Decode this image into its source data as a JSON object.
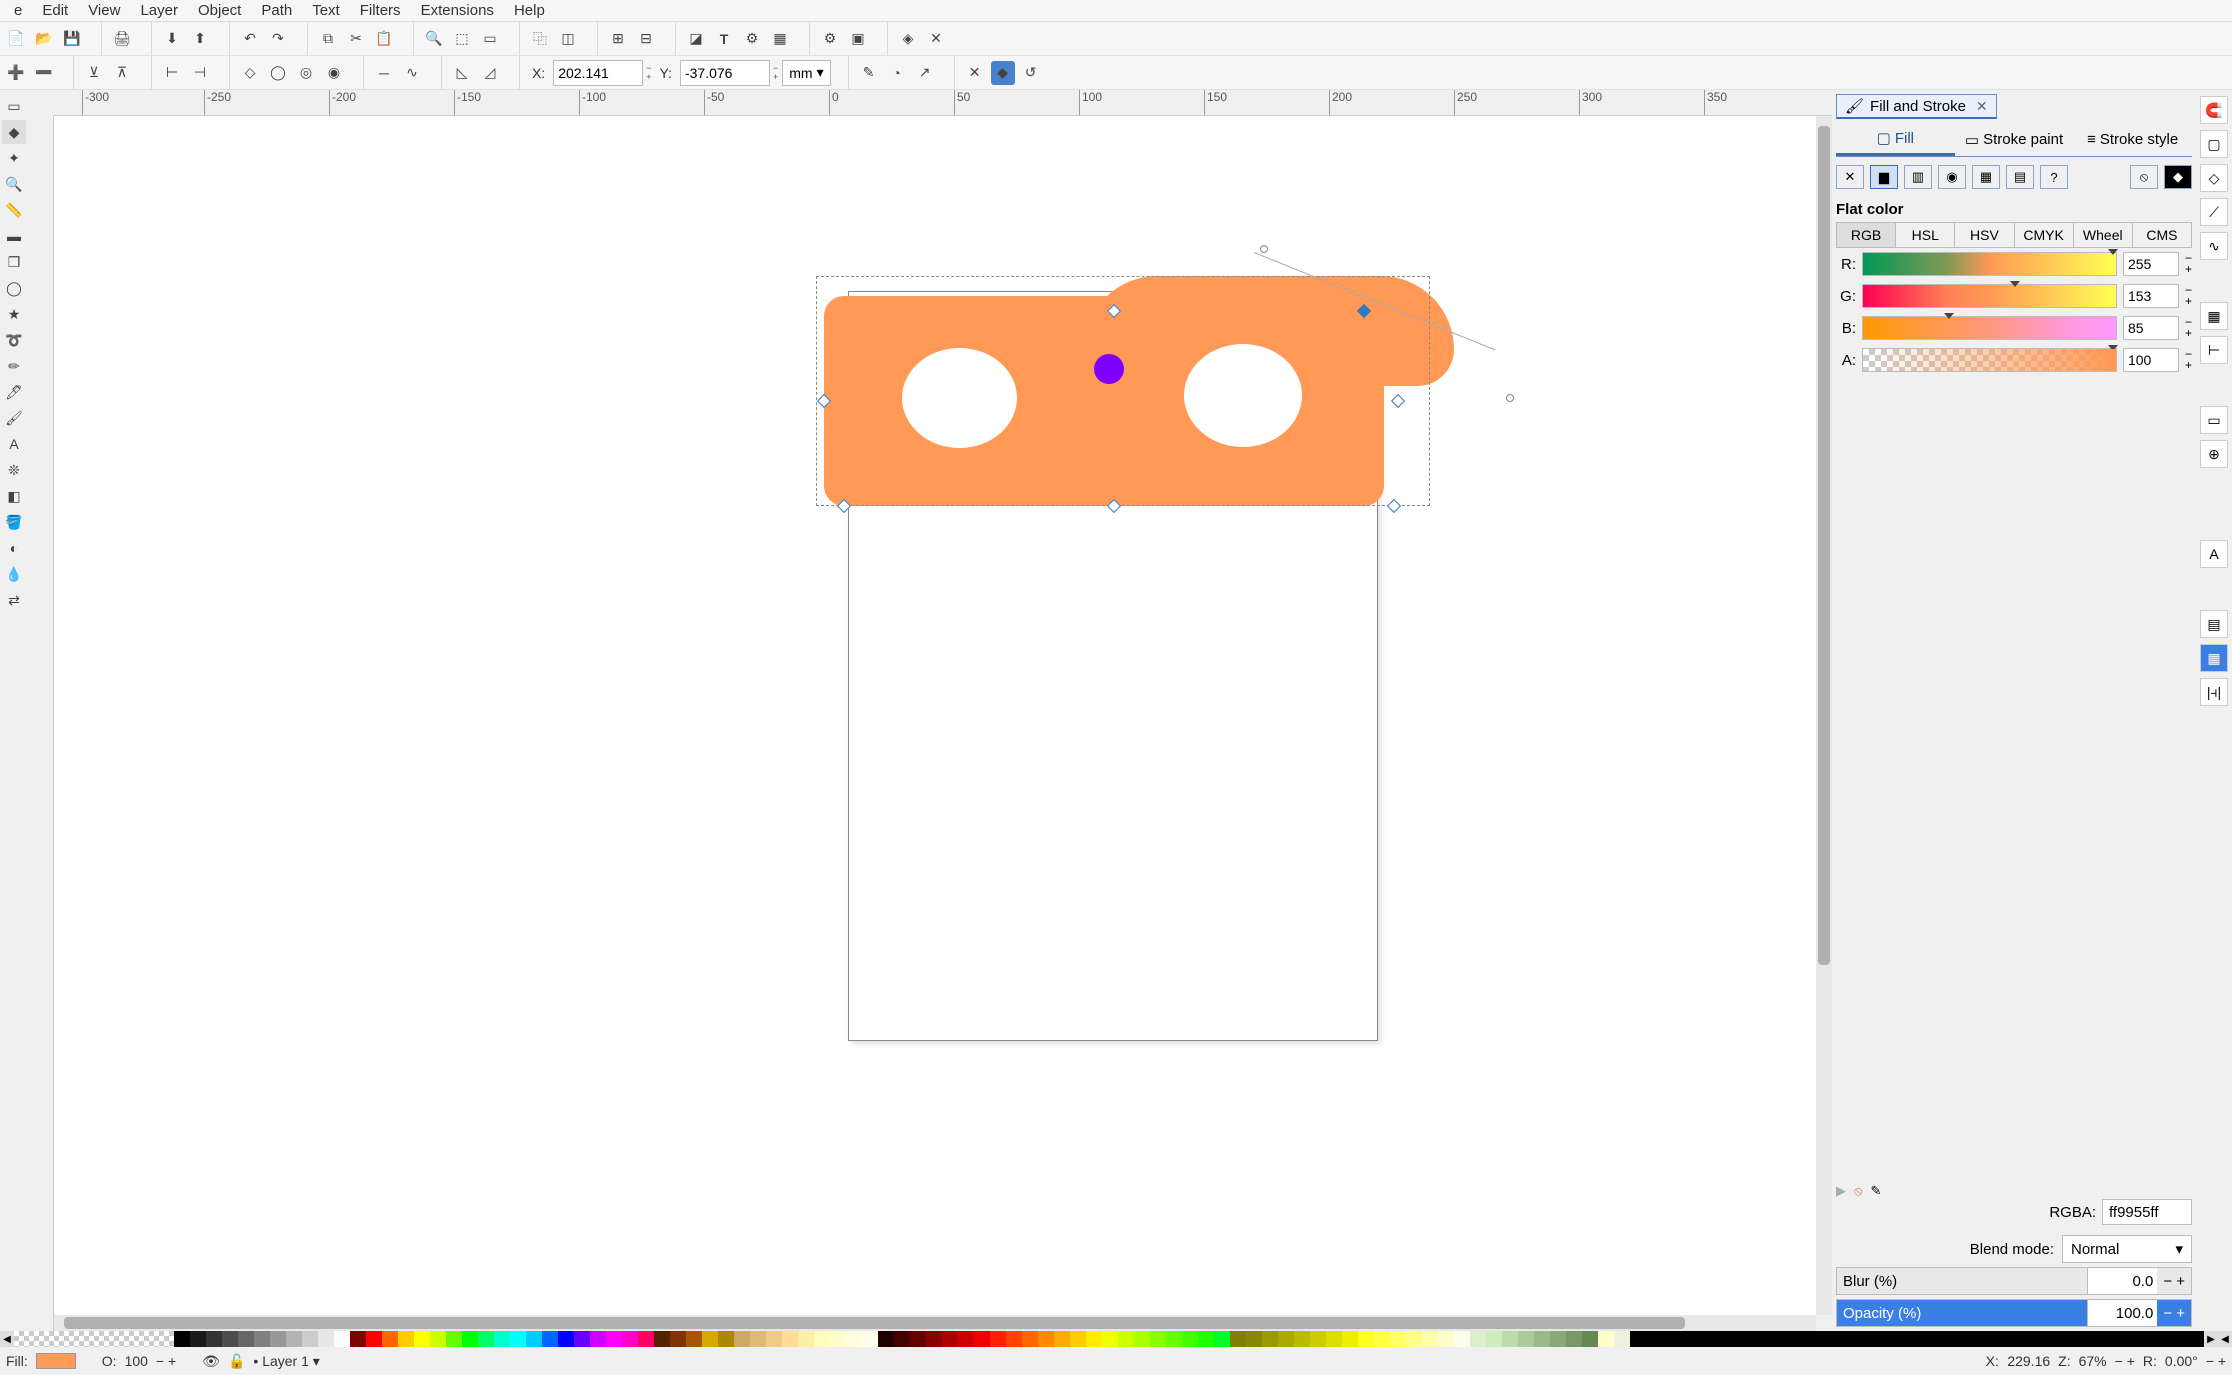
{
  "menubar": {
    "items": [
      "e",
      "Edit",
      "View",
      "Layer",
      "Object",
      "Path",
      "Text",
      "Filters",
      "Extensions",
      "Help"
    ]
  },
  "toolbar1_icons": [
    "new",
    "open",
    "save",
    "sep",
    "print",
    "sep",
    "import",
    "export",
    "sep",
    "undo",
    "redo",
    "sep",
    "copy",
    "cut",
    "paste",
    "sep",
    "clone",
    "unlink",
    "stamp",
    "sep",
    "zoom-sel",
    "zoom-draw",
    "zoom-page",
    "sep",
    "dup",
    "clone2",
    "sep",
    "text",
    "sep",
    "xml",
    "sep",
    "align",
    "sep",
    "props",
    "prefs",
    "sep",
    "spray",
    "sep",
    "fullscreen"
  ],
  "toolbar2": {
    "x_label": "X:",
    "x_value": "202.141",
    "y_label": "Y:",
    "y_value": "-37.076",
    "unit": "mm"
  },
  "ruler_h": [
    "-300",
    "-250",
    "-200",
    "-150",
    "-100",
    "-50",
    "0",
    "50",
    "100",
    "150",
    "200",
    "250",
    "300",
    "350"
  ],
  "ruler_v": [
    "",
    "",
    "",
    "",
    ""
  ],
  "fill_stroke": {
    "title": "Fill and Stroke",
    "tabs": {
      "fill": "Fill",
      "stroke_paint": "Stroke paint",
      "stroke_style": "Stroke style"
    },
    "flat_color": "Flat color",
    "color_tabs": [
      "RGB",
      "HSL",
      "HSV",
      "CMYK",
      "Wheel",
      "CMS"
    ],
    "r_label": "R:",
    "r_value": "255",
    "g_label": "G:",
    "g_value": "153",
    "b_label": "B:",
    "b_value": "85",
    "a_label": "A:",
    "a_value": "100",
    "rgba_label": "RGBA:",
    "rgba_value": "ff9955ff",
    "blend_label": "Blend mode:",
    "blend_value": "Normal",
    "blur_label": "Blur (%)",
    "blur_value": "0.0",
    "opacity_label": "Opacity (%)",
    "opacity_value": "100.0"
  },
  "status": {
    "fill_label": "Fill:",
    "o_label": "O:",
    "o_value": "100",
    "layer_value": "Layer 1",
    "coord_x_label": "X:",
    "coord_x_value": "229.16",
    "z_label": "Z:",
    "z_value": "67%",
    "r_label": "R:",
    "r_value": "0.00°"
  },
  "palette_colors": [
    "#000000",
    "#1a1a1a",
    "#333333",
    "#4d4d4d",
    "#666666",
    "#808080",
    "#999999",
    "#b3b3b3",
    "#cccccc",
    "#e6e6e6",
    "#ffffff",
    "#800000",
    "#ff0000",
    "#ff6600",
    "#ffcc00",
    "#ffff00",
    "#ccff00",
    "#66ff00",
    "#00ff00",
    "#00ff66",
    "#00ffcc",
    "#00ffff",
    "#00ccff",
    "#0066ff",
    "#0000ff",
    "#6600ff",
    "#cc00ff",
    "#ff00ff",
    "#ff00cc",
    "#ff0066",
    "#552200",
    "#803300",
    "#aa5500",
    "#d4aa00",
    "#aa8800",
    "#ccaa66",
    "#ddbb77",
    "#eecc88",
    "#ffdd99",
    "#ffeeaa",
    "#ffffbb",
    "#ffffcc",
    "#ffffdd",
    "#ffffee",
    "#220000",
    "#440000",
    "#660000",
    "#880000",
    "#aa0000",
    "#cc0000",
    "#ee0000",
    "#ff2200",
    "#ff4400",
    "#ff6600",
    "#ff8800",
    "#ffaa00",
    "#ffcc00",
    "#ffee00",
    "#eeff00",
    "#ccff00",
    "#aaff00",
    "#88ff00",
    "#66ff00",
    "#44ff00",
    "#22ff00",
    "#00ff22",
    "#808000",
    "#888800",
    "#999900",
    "#aaaa00",
    "#bbbb00",
    "#cccc00",
    "#dddd00",
    "#eeee00",
    "#ffff22",
    "#ffff44",
    "#ffff66",
    "#ffff88",
    "#ffffaa",
    "#ffffcc",
    "#ffffee",
    "#ddeecc",
    "#cceebb",
    "#bbddaa",
    "#aacc99",
    "#99bb88",
    "#88aa77",
    "#779966",
    "#668855",
    "#ffffcc",
    "#f0f0e0"
  ]
}
